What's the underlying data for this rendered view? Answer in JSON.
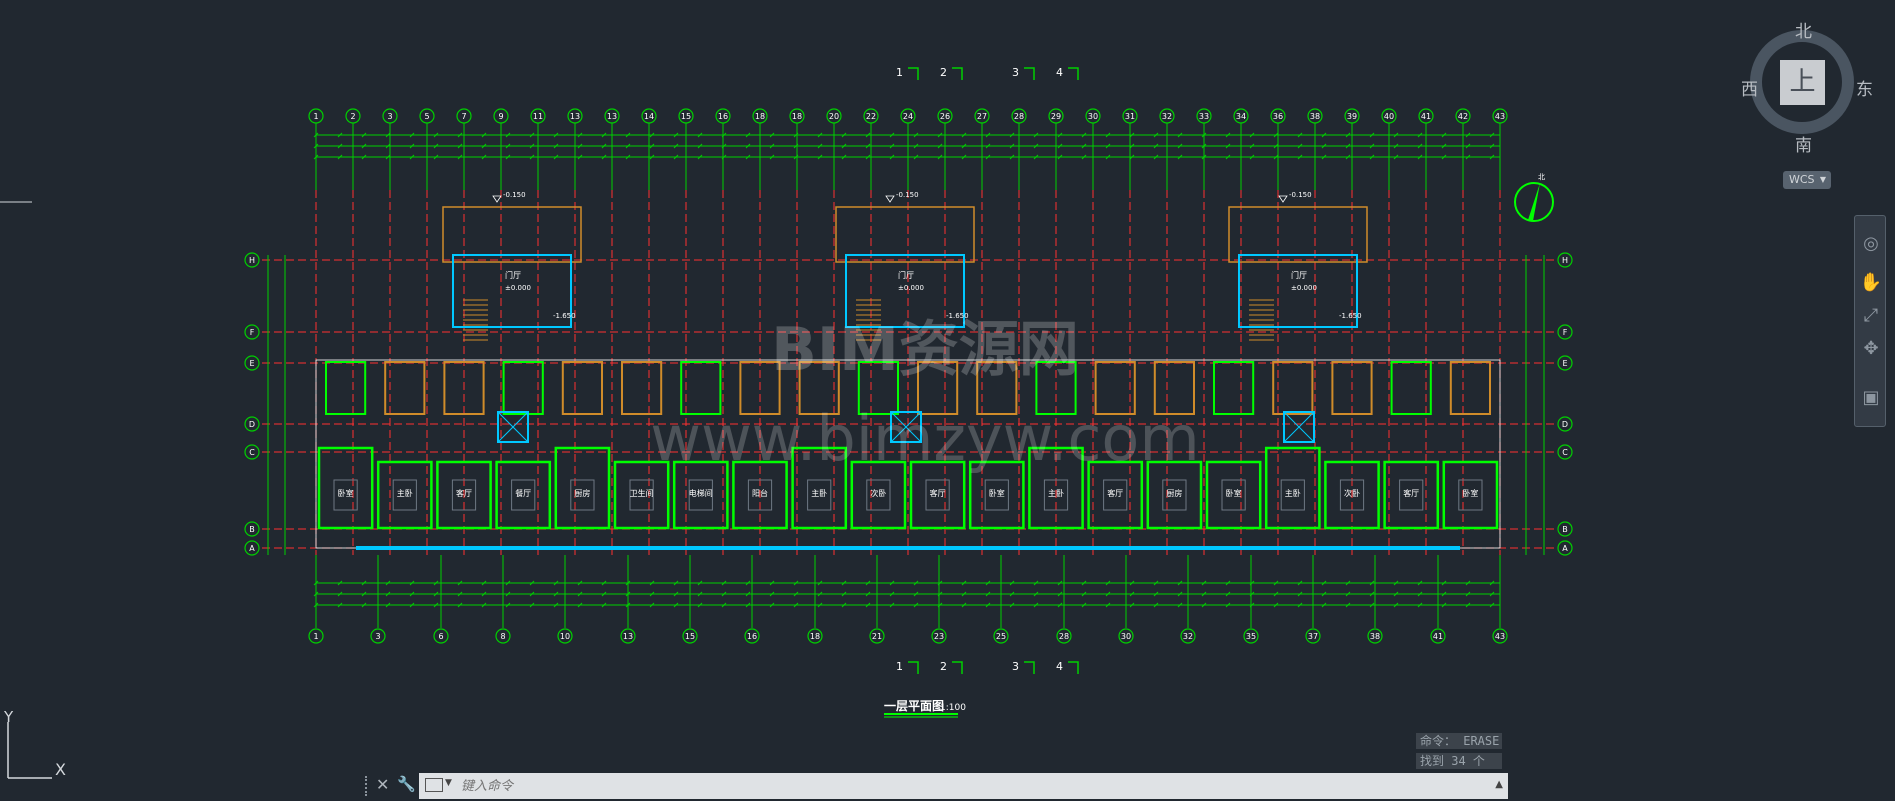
{
  "viewcube": {
    "top_face": "上",
    "north": "北",
    "south": "南",
    "east": "东",
    "west": "西",
    "wcs_label": "WCS"
  },
  "command_history": [
    "命令： ERASE",
    "找到 34 个"
  ],
  "command_line": {
    "placeholder": "键入命令"
  },
  "drawing": {
    "title": "一层平面图",
    "scale": "1:100",
    "elevation_outdoor": "-0.150",
    "elevation_hall": "±0.000",
    "elevation_stair": "-1.650",
    "hall_label": "门厅",
    "watermark_top": "BIM资源网",
    "watermark_bottom": "www.bimzyw.com",
    "section_marks": [
      "1",
      "2",
      "3",
      "4"
    ],
    "axis_top": [
      "1",
      "2",
      "3",
      "5",
      "7",
      "9",
      "11",
      "13",
      "13",
      "14",
      "15",
      "16",
      "18",
      "18",
      "20",
      "22",
      "24",
      "26",
      "27",
      "28",
      "29",
      "30",
      "31",
      "32",
      "33",
      "34",
      "36",
      "38",
      "39",
      "40",
      "41",
      "42",
      "43"
    ],
    "axis_bottom": [
      "1",
      "3",
      "6",
      "8",
      "10",
      "13",
      "15",
      "16",
      "18",
      "21",
      "23",
      "25",
      "28",
      "30",
      "32",
      "35",
      "37",
      "38",
      "41",
      "43"
    ],
    "axis_rows": [
      "H",
      "F",
      "E",
      "D",
      "C",
      "B",
      "A"
    ],
    "room_labels": [
      "卧室",
      "主卧",
      "客厅",
      "餐厅",
      "厨房",
      "卫生间",
      "电梯间",
      "阳台",
      "主卧",
      "次卧",
      "客厅",
      "卧室",
      "主卧",
      "客厅",
      "厨房",
      "卧室",
      "主卧",
      "次卧",
      "客厅",
      "卧室"
    ]
  },
  "ucs": {
    "x": "X",
    "y": "Y"
  },
  "colors": {
    "background": "#212830",
    "wall": "#00ff00",
    "axis": "#ff3030",
    "dimension": "#00d000",
    "window": "#00c8ff",
    "stair": "#d08c2a",
    "white_line": "#ffffff"
  }
}
